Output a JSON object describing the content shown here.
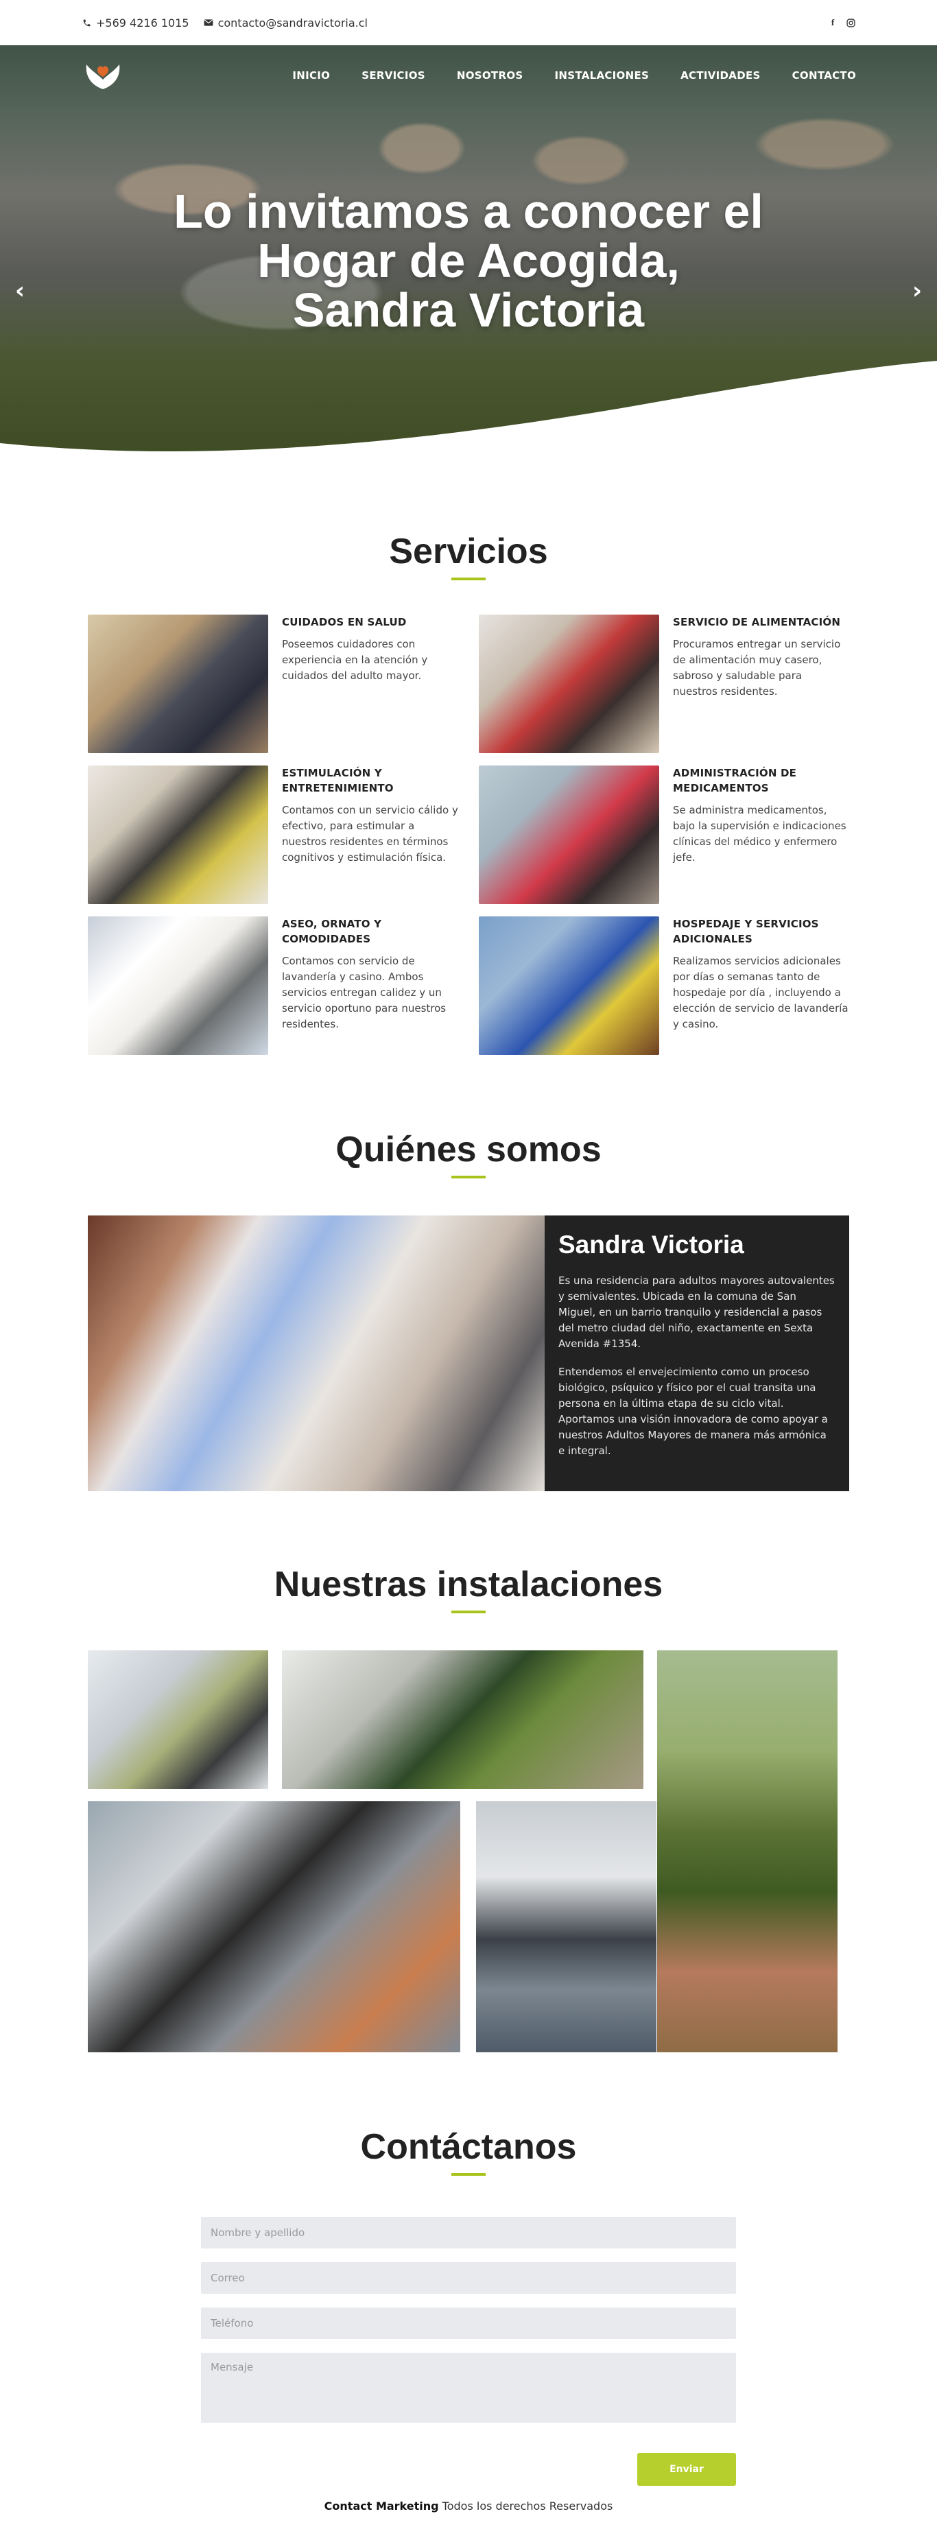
{
  "topbar": {
    "phone": "+569 4216 1015",
    "email": "contacto@sandravictoria.cl",
    "phone_icon": "phone-icon",
    "email_icon": "envelope-icon",
    "social": [
      "facebook-icon",
      "instagram-icon"
    ]
  },
  "nav": {
    "items": [
      "INICIO",
      "SERVICIOS",
      "NOSOTROS",
      "INSTALACIONES",
      "ACTIVIDADES",
      "CONTACTO"
    ]
  },
  "hero": {
    "title_line1": "Lo invitamos a conocer el",
    "title_line2": "Hogar de Acogida,",
    "title_line3": "Sandra Victoria",
    "prev": "‹",
    "next": "›"
  },
  "services": {
    "title": "Servicios",
    "items": [
      {
        "title": "CUIDADOS EN SALUD",
        "text": "Poseemos cuidadores con experiencia en la atención y cuidados del adulto mayor."
      },
      {
        "title": "SERVICIO DE ALIMENTACIÓN",
        "text": "Procuramos entregar un servicio de alimentación muy casero, sabroso y saludable para nuestros residentes."
      },
      {
        "title": "ESTIMULACIÓN Y ENTRETENIMIENTO",
        "text": "Contamos con un servicio cálido y efectivo, para estimular a nuestros residentes en términos cognitivos y estimulación física."
      },
      {
        "title": "ADMINISTRACIÓN DE MEDICAMENTOS",
        "text": "Se administra medicamentos, bajo la supervisión e indicaciones clínicas del médico y enfermero jefe."
      },
      {
        "title": "ASEO, ORNATO Y COMODIDADES",
        "text": "Contamos con servicio de lavandería y casino. Ambos servicios entregan calidez y un servicio oportuno para nuestros residentes."
      },
      {
        "title": "HOSPEDAJE Y SERVICIOS ADICIONALES",
        "text": "Realizamos servicios adicionales por días o semanas tanto de hospedaje por día , incluyendo a elección de servicio de lavandería y casino."
      }
    ]
  },
  "about": {
    "title": "Quiénes somos",
    "name": "Sandra Victoria",
    "p1": "Es una residencia para adultos mayores autovalentes y semivalentes. Ubicada en la comuna de San Miguel, en un barrio tranquilo y residencial a pasos del metro ciudad del niño, exactamente en Sexta Avenida #1354.",
    "p2": "Entendemos el envejecimiento como un proceso biológico, psíquico y físico por el cual transita una persona en la última etapa de su ciclo vital. Aportamos una visión innovadora de como apoyar a nuestros Adultos Mayores de manera más armónica e integral."
  },
  "installations": {
    "title": "Nuestras instalaciones"
  },
  "contact": {
    "title": "Contáctanos",
    "name_ph": "Nombre y apellido",
    "email_ph": "Correo",
    "phone_ph": "Teléfono",
    "message_ph": "Mensaje",
    "send": "Enviar"
  },
  "footer": {
    "brand": "Contact Marketing",
    "text": " Todos los derechos Reservados"
  },
  "colors": {
    "accent": "#a9c31b",
    "dark_panel": "#222222",
    "button": "#b7cf2c",
    "input_bg": "#e9eaee"
  }
}
